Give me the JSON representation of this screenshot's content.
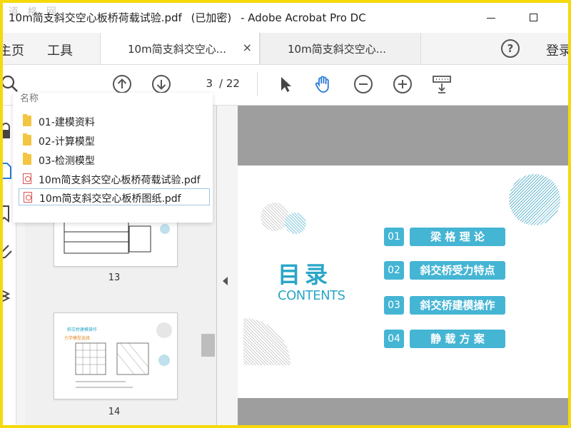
{
  "window": {
    "watermark": "道 格 网",
    "title_parts": [
      "10m简支斜交空心板桥荷载试验.pdf",
      "(已加密)",
      "- Adobe Acrobat Pro DC"
    ]
  },
  "nav": {
    "home": "主页",
    "tools": "工具",
    "help": "?",
    "login": "登录"
  },
  "tabs": [
    {
      "label": "10m简支斜交空心...",
      "close": "×"
    },
    {
      "label": "10m简支斜交空心..."
    }
  ],
  "toolbar": {
    "page_current": "3",
    "page_total": "/ 22"
  },
  "popup": {
    "header": "名称",
    "items": [
      {
        "type": "folder",
        "name": "01-建模资料"
      },
      {
        "type": "folder",
        "name": "02-计算模型"
      },
      {
        "type": "folder",
        "name": "03-检测模型"
      },
      {
        "type": "pdf",
        "name": "10m简支斜交空心板桥荷载试验.pdf"
      },
      {
        "type": "pdf",
        "name": "10m简支斜交空心板桥图纸.pdf",
        "selected": true
      }
    ]
  },
  "thumbnails": [
    {
      "label": "13"
    },
    {
      "label": "14",
      "title": "斜交桥建模操作",
      "subtitle": "力学模型选择"
    }
  ],
  "page": {
    "title_cn": "目录",
    "title_en": "CONTENTS",
    "toc": [
      {
        "num": "01",
        "label": "梁 格 理 论"
      },
      {
        "num": "02",
        "label": "斜交桥受力特点"
      },
      {
        "num": "03",
        "label": "斜交桥建模操作"
      },
      {
        "num": "04",
        "label": "静 载 方 案"
      }
    ]
  },
  "colors": {
    "accent": "#45b5d4",
    "frame": "#f5d90a",
    "hand_tool": "#2a7bd6"
  }
}
